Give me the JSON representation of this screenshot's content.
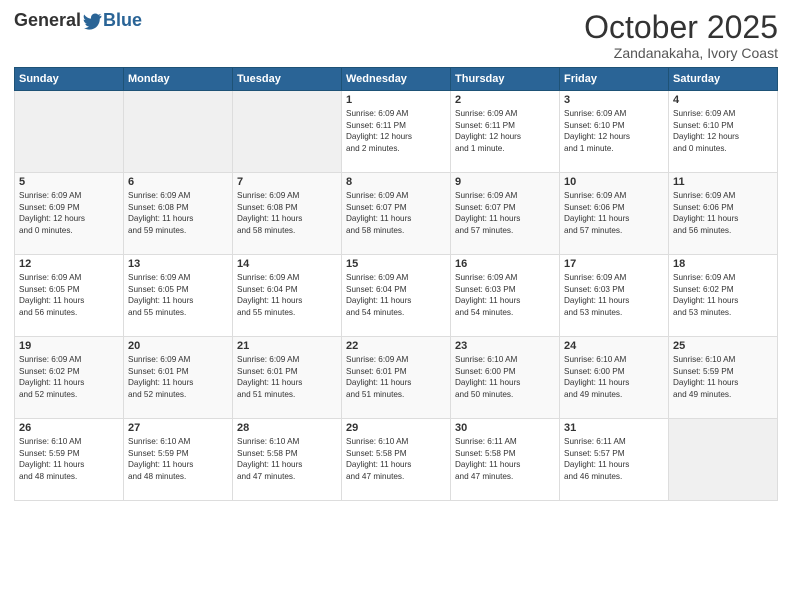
{
  "logo": {
    "general": "General",
    "blue": "Blue"
  },
  "header": {
    "month": "October 2025",
    "location": "Zandanakaha, Ivory Coast"
  },
  "weekdays": [
    "Sunday",
    "Monday",
    "Tuesday",
    "Wednesday",
    "Thursday",
    "Friday",
    "Saturday"
  ],
  "weeks": [
    [
      {
        "day": "",
        "info": ""
      },
      {
        "day": "",
        "info": ""
      },
      {
        "day": "",
        "info": ""
      },
      {
        "day": "1",
        "info": "Sunrise: 6:09 AM\nSunset: 6:11 PM\nDaylight: 12 hours\nand 2 minutes."
      },
      {
        "day": "2",
        "info": "Sunrise: 6:09 AM\nSunset: 6:11 PM\nDaylight: 12 hours\nand 1 minute."
      },
      {
        "day": "3",
        "info": "Sunrise: 6:09 AM\nSunset: 6:10 PM\nDaylight: 12 hours\nand 1 minute."
      },
      {
        "day": "4",
        "info": "Sunrise: 6:09 AM\nSunset: 6:10 PM\nDaylight: 12 hours\nand 0 minutes."
      }
    ],
    [
      {
        "day": "5",
        "info": "Sunrise: 6:09 AM\nSunset: 6:09 PM\nDaylight: 12 hours\nand 0 minutes."
      },
      {
        "day": "6",
        "info": "Sunrise: 6:09 AM\nSunset: 6:08 PM\nDaylight: 11 hours\nand 59 minutes."
      },
      {
        "day": "7",
        "info": "Sunrise: 6:09 AM\nSunset: 6:08 PM\nDaylight: 11 hours\nand 58 minutes."
      },
      {
        "day": "8",
        "info": "Sunrise: 6:09 AM\nSunset: 6:07 PM\nDaylight: 11 hours\nand 58 minutes."
      },
      {
        "day": "9",
        "info": "Sunrise: 6:09 AM\nSunset: 6:07 PM\nDaylight: 11 hours\nand 57 minutes."
      },
      {
        "day": "10",
        "info": "Sunrise: 6:09 AM\nSunset: 6:06 PM\nDaylight: 11 hours\nand 57 minutes."
      },
      {
        "day": "11",
        "info": "Sunrise: 6:09 AM\nSunset: 6:06 PM\nDaylight: 11 hours\nand 56 minutes."
      }
    ],
    [
      {
        "day": "12",
        "info": "Sunrise: 6:09 AM\nSunset: 6:05 PM\nDaylight: 11 hours\nand 56 minutes."
      },
      {
        "day": "13",
        "info": "Sunrise: 6:09 AM\nSunset: 6:05 PM\nDaylight: 11 hours\nand 55 minutes."
      },
      {
        "day": "14",
        "info": "Sunrise: 6:09 AM\nSunset: 6:04 PM\nDaylight: 11 hours\nand 55 minutes."
      },
      {
        "day": "15",
        "info": "Sunrise: 6:09 AM\nSunset: 6:04 PM\nDaylight: 11 hours\nand 54 minutes."
      },
      {
        "day": "16",
        "info": "Sunrise: 6:09 AM\nSunset: 6:03 PM\nDaylight: 11 hours\nand 54 minutes."
      },
      {
        "day": "17",
        "info": "Sunrise: 6:09 AM\nSunset: 6:03 PM\nDaylight: 11 hours\nand 53 minutes."
      },
      {
        "day": "18",
        "info": "Sunrise: 6:09 AM\nSunset: 6:02 PM\nDaylight: 11 hours\nand 53 minutes."
      }
    ],
    [
      {
        "day": "19",
        "info": "Sunrise: 6:09 AM\nSunset: 6:02 PM\nDaylight: 11 hours\nand 52 minutes."
      },
      {
        "day": "20",
        "info": "Sunrise: 6:09 AM\nSunset: 6:01 PM\nDaylight: 11 hours\nand 52 minutes."
      },
      {
        "day": "21",
        "info": "Sunrise: 6:09 AM\nSunset: 6:01 PM\nDaylight: 11 hours\nand 51 minutes."
      },
      {
        "day": "22",
        "info": "Sunrise: 6:09 AM\nSunset: 6:01 PM\nDaylight: 11 hours\nand 51 minutes."
      },
      {
        "day": "23",
        "info": "Sunrise: 6:10 AM\nSunset: 6:00 PM\nDaylight: 11 hours\nand 50 minutes."
      },
      {
        "day": "24",
        "info": "Sunrise: 6:10 AM\nSunset: 6:00 PM\nDaylight: 11 hours\nand 49 minutes."
      },
      {
        "day": "25",
        "info": "Sunrise: 6:10 AM\nSunset: 5:59 PM\nDaylight: 11 hours\nand 49 minutes."
      }
    ],
    [
      {
        "day": "26",
        "info": "Sunrise: 6:10 AM\nSunset: 5:59 PM\nDaylight: 11 hours\nand 48 minutes."
      },
      {
        "day": "27",
        "info": "Sunrise: 6:10 AM\nSunset: 5:59 PM\nDaylight: 11 hours\nand 48 minutes."
      },
      {
        "day": "28",
        "info": "Sunrise: 6:10 AM\nSunset: 5:58 PM\nDaylight: 11 hours\nand 47 minutes."
      },
      {
        "day": "29",
        "info": "Sunrise: 6:10 AM\nSunset: 5:58 PM\nDaylight: 11 hours\nand 47 minutes."
      },
      {
        "day": "30",
        "info": "Sunrise: 6:11 AM\nSunset: 5:58 PM\nDaylight: 11 hours\nand 47 minutes."
      },
      {
        "day": "31",
        "info": "Sunrise: 6:11 AM\nSunset: 5:57 PM\nDaylight: 11 hours\nand 46 minutes."
      },
      {
        "day": "",
        "info": ""
      }
    ]
  ]
}
